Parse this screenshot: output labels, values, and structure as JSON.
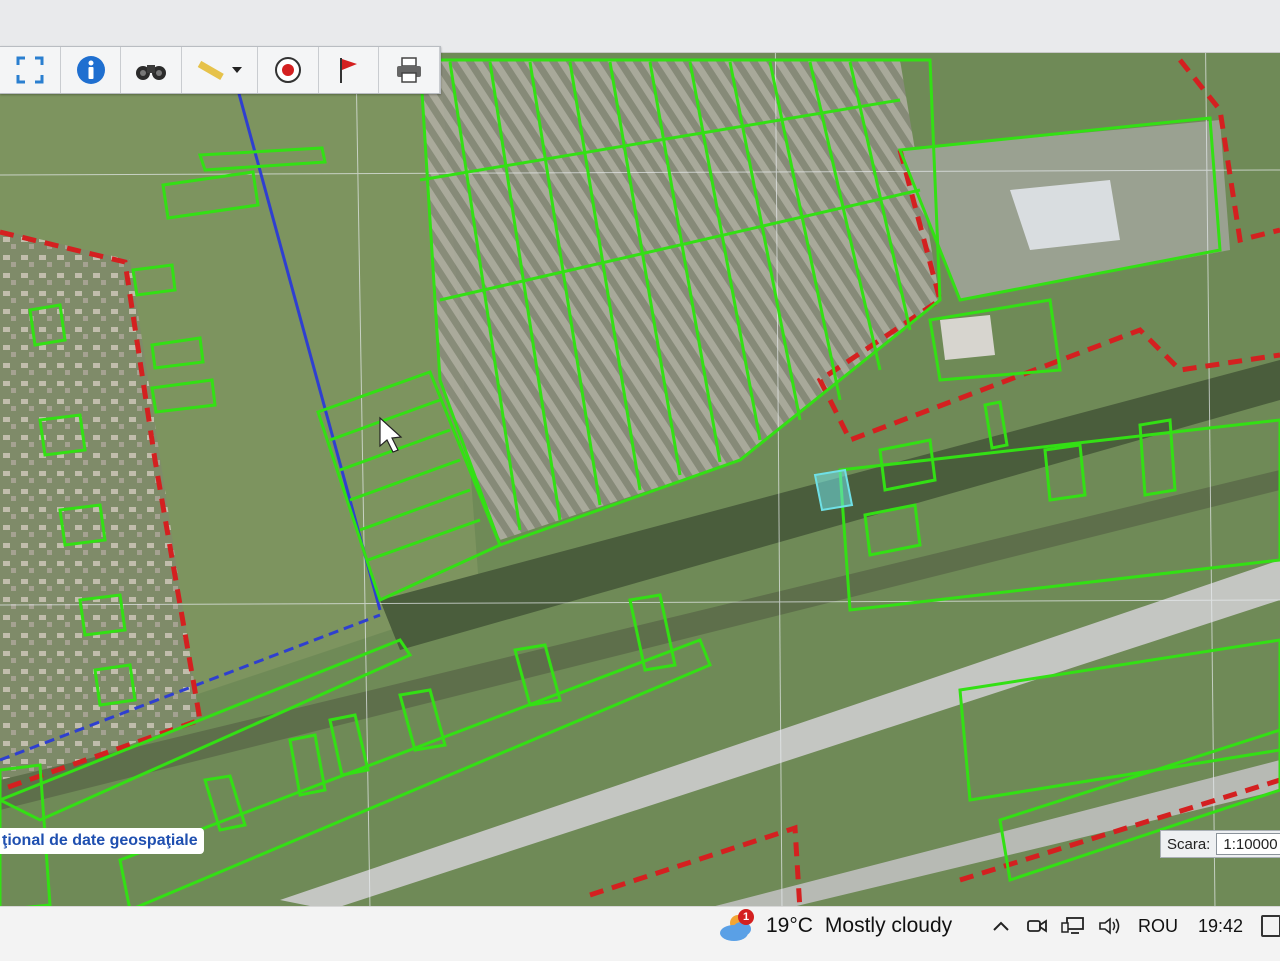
{
  "toolbar": {
    "buttons": [
      {
        "id": "fullextent",
        "icon": "fullscreen-icon"
      },
      {
        "id": "info",
        "icon": "info-icon"
      },
      {
        "id": "search",
        "icon": "binoculars-icon"
      },
      {
        "id": "measure",
        "icon": "ruler-icon"
      },
      {
        "id": "record",
        "icon": "record-icon"
      },
      {
        "id": "flag",
        "icon": "flag-icon"
      },
      {
        "id": "print",
        "icon": "printer-icon"
      }
    ]
  },
  "map": {
    "attribution": "ţional de date geospaţiale",
    "scale_label": "Scara:",
    "scale_value": "1:10000",
    "colors": {
      "parcel": "#33e014",
      "boundary": "#d42020",
      "road_line": "#2f3fd0",
      "selected": "#6fe0e6"
    }
  },
  "taskbar": {
    "weather_badge": "1",
    "temperature": "19°C",
    "condition": "Mostly cloudy",
    "language": "ROU",
    "time": "19:42"
  }
}
